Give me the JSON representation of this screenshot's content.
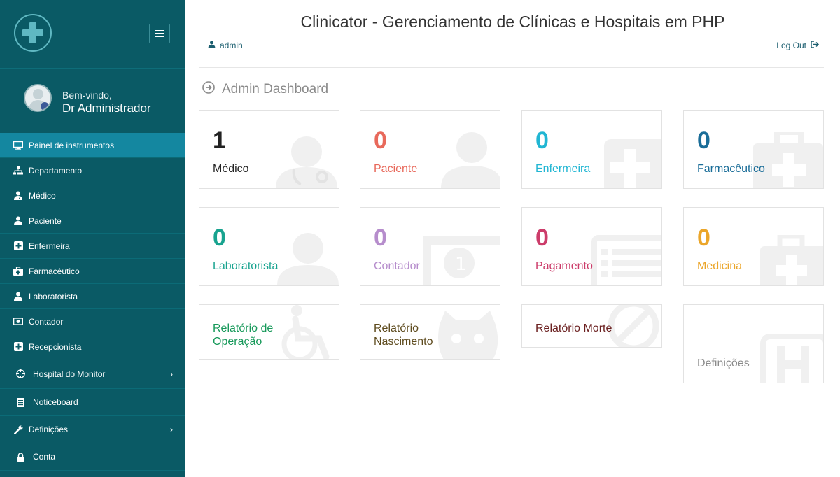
{
  "app_title": "Clinicator - Gerenciamento de Clínicas e Hospitais em PHP",
  "header": {
    "user": "admin",
    "logout": "Log Out"
  },
  "sidebar": {
    "welcome": "Bem-vindo,",
    "admin_name": "Dr Administrador",
    "items": [
      {
        "label": "Painel de instrumentos",
        "icon": "monitor-icon"
      },
      {
        "label": "Departamento",
        "icon": "sitemap-icon"
      },
      {
        "label": "Médico",
        "icon": "doctor-icon"
      },
      {
        "label": "Paciente",
        "icon": "user-icon"
      },
      {
        "label": "Enfermeira",
        "icon": "plus-square-icon"
      },
      {
        "label": "Farmacêutico",
        "icon": "medkit-icon"
      },
      {
        "label": "Laboratorista",
        "icon": "user-icon"
      },
      {
        "label": "Contador",
        "icon": "money-icon"
      },
      {
        "label": "Recepcionista",
        "icon": "plus-square-icon"
      },
      {
        "label": "Hospital do Monitor",
        "icon": "crosshair-icon"
      },
      {
        "label": "Noticeboard",
        "icon": "list-icon"
      },
      {
        "label": "Definições",
        "icon": "wrench-icon"
      },
      {
        "label": "Conta",
        "icon": "lock-icon"
      }
    ]
  },
  "dashboard_title": "Admin Dashboard",
  "cards": [
    {
      "num": "1",
      "label": "Médico",
      "color": "#222222"
    },
    {
      "num": "0",
      "label": "Paciente",
      "color": "#e8695b"
    },
    {
      "num": "0",
      "label": "Enfermeira",
      "color": "#21b6d3"
    },
    {
      "num": "0",
      "label": "Farmacêutico",
      "color": "#1a6d98"
    },
    {
      "num": "0",
      "label": "Laboratorista",
      "color": "#18a38f"
    },
    {
      "num": "0",
      "label": "Contador",
      "color": "#b68dcc"
    },
    {
      "num": "0",
      "label": "Pagamento",
      "color": "#cc3c6a"
    },
    {
      "num": "0",
      "label": "Medicina",
      "color": "#eba62a"
    }
  ],
  "reports": [
    {
      "label": "Relatório de Operação",
      "color": "#17995a"
    },
    {
      "label": "Relatório Nascimento",
      "color": "#5e4b1e"
    },
    {
      "label": "Relatório Morte",
      "color": "#6b2020"
    },
    {
      "label": "Definições",
      "color": "#8a8a8a"
    }
  ]
}
